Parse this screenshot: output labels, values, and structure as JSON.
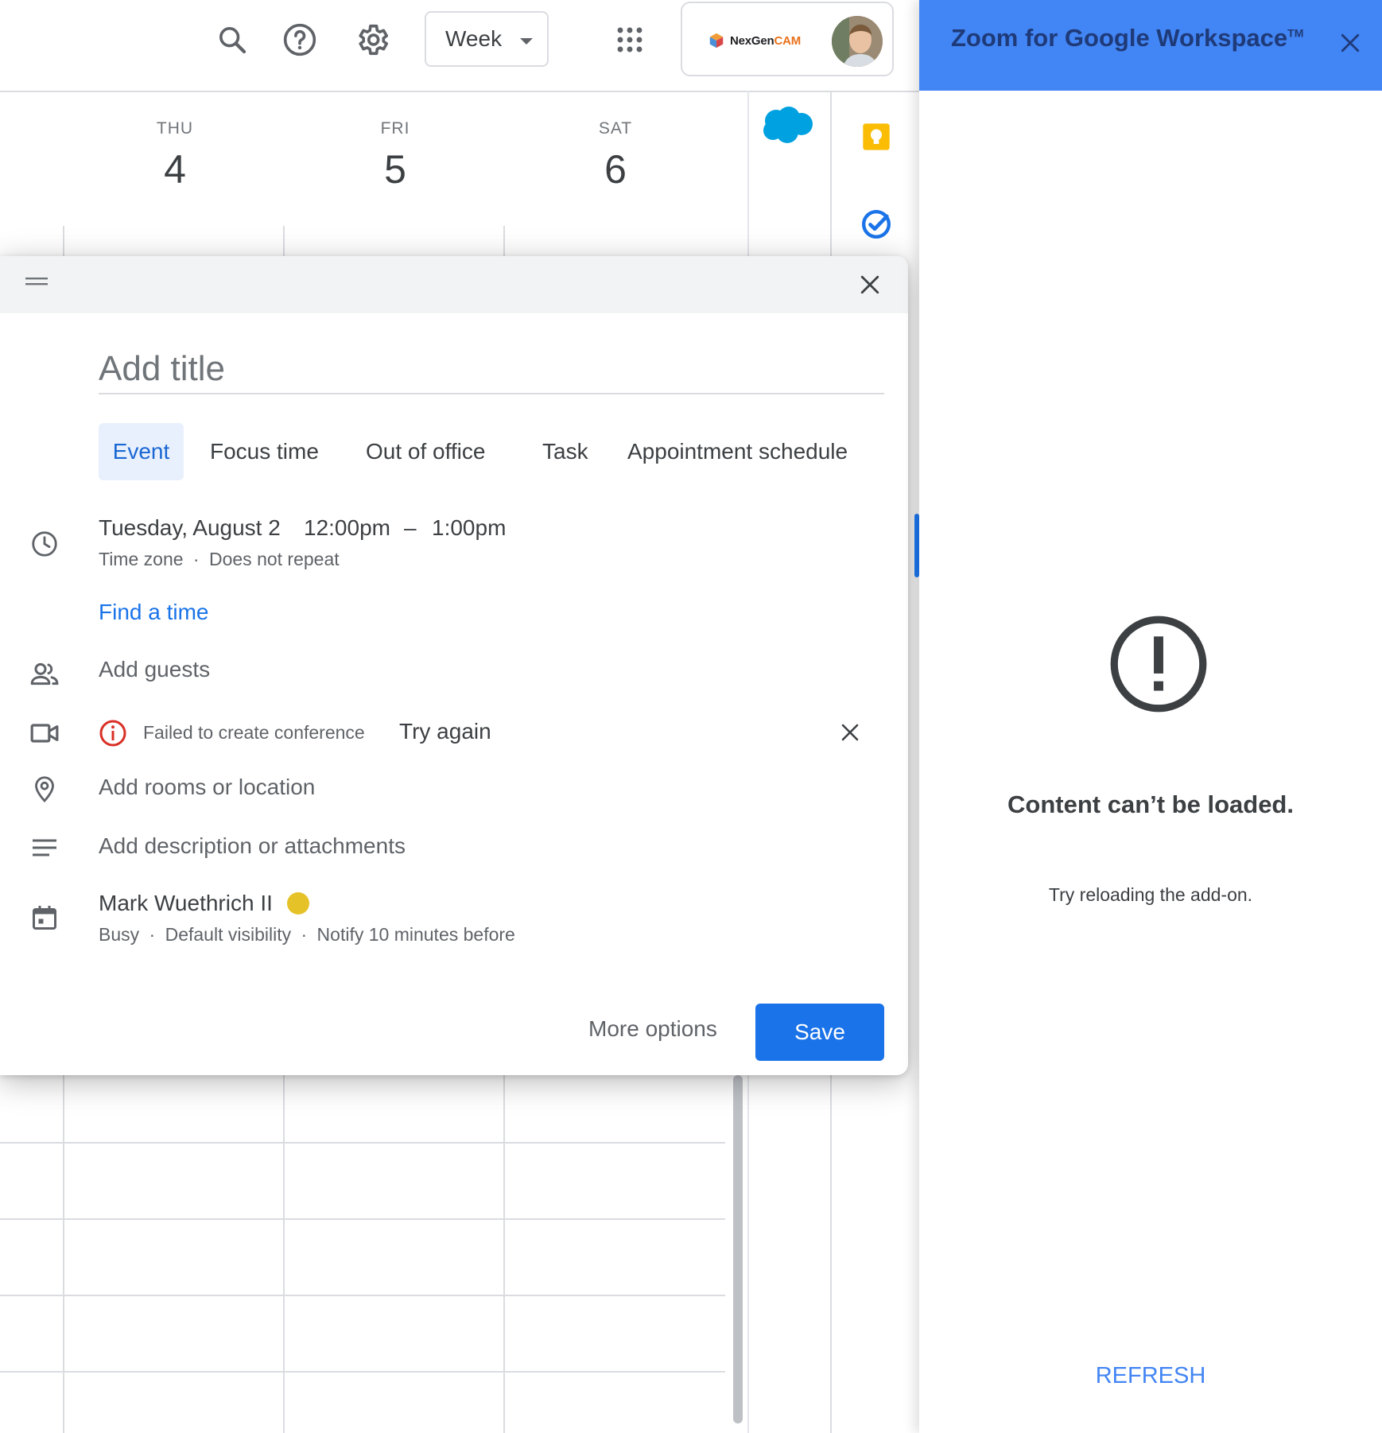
{
  "topbar": {
    "view_label": "Week",
    "brand_name": "NexGen",
    "brand_suffix": "CAM"
  },
  "calendar": {
    "days": [
      {
        "name": "THU",
        "num": "4"
      },
      {
        "name": "FRI",
        "num": "5"
      },
      {
        "name": "SAT",
        "num": "6"
      }
    ]
  },
  "dialog": {
    "title_placeholder": "Add title",
    "tabs": [
      "Event",
      "Focus time",
      "Out of office",
      "Task",
      "Appointment schedule"
    ],
    "date": "Tuesday, August 2",
    "start_time": "12:00pm",
    "time_dash": "–",
    "end_time": "1:00pm",
    "time_zone": "Time zone",
    "repeat": "Does not repeat",
    "find_time": "Find a time",
    "add_guests": "Add guests",
    "conference_error": "Failed to create conference",
    "try_again": "Try again",
    "add_location": "Add rooms or location",
    "add_description": "Add description or attachments",
    "calendar_owner": "Mark Wuethrich II",
    "busy": "Busy",
    "visibility": "Default visibility",
    "notify": "Notify 10 minutes before",
    "more_options": "More options",
    "save": "Save",
    "separator": "·"
  },
  "panel": {
    "title": "Zoom for Google Workspace",
    "tm": "TM",
    "message": "Content can’t be loaded.",
    "hint": "Try reloading the add-on.",
    "refresh": "REFRESH"
  },
  "colors": {
    "accent": "#1a73e8",
    "panel_header": "#4285f4",
    "tab_active_bg": "#e8f0fe",
    "calendar_dot": "#e6c229",
    "error": "#d93025"
  }
}
